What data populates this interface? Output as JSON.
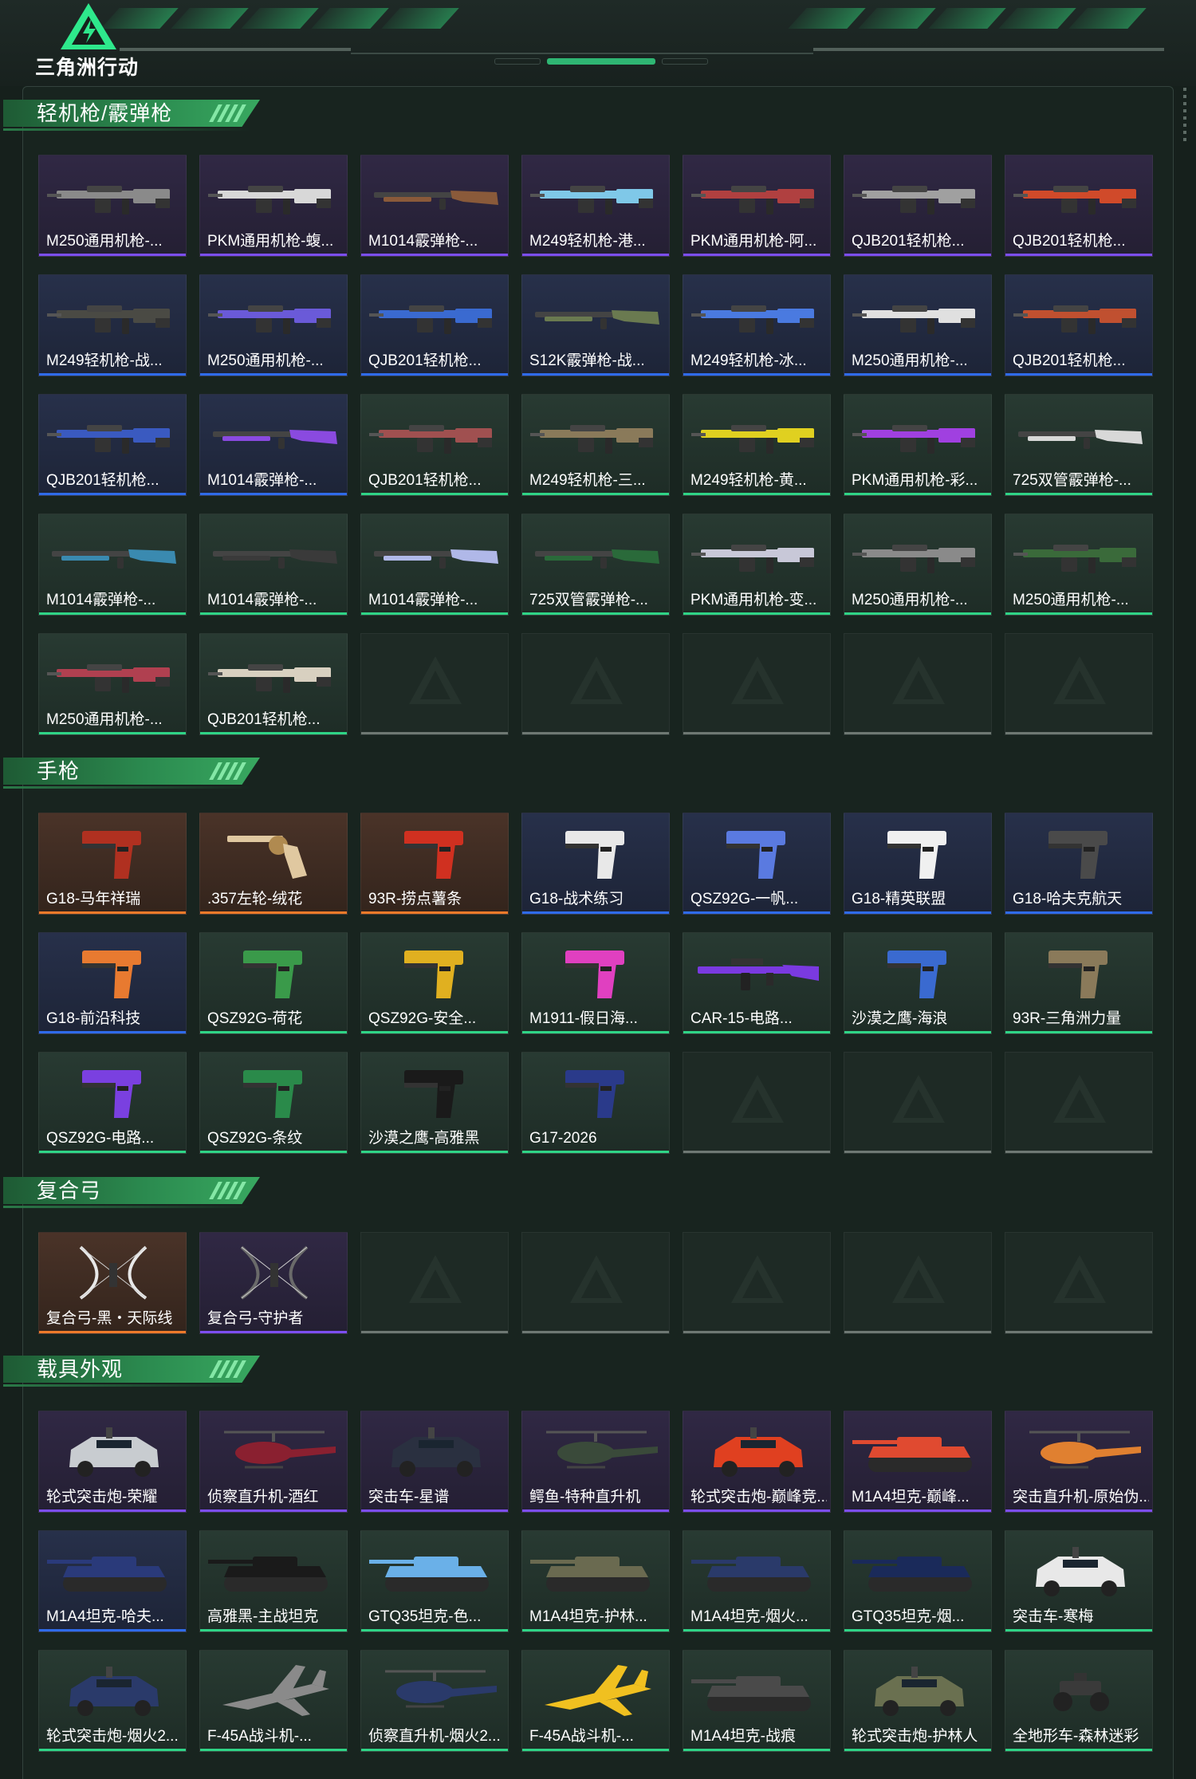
{
  "app": {
    "logo_text": "三角洲行动"
  },
  "colors": {
    "purple": "#7c4ef0",
    "blue": "#2f6bea",
    "green": "#2fd486",
    "orange": "#ee7a2a",
    "empty": "#6e7873",
    "accent": "#38a860"
  },
  "sections": [
    {
      "title": "轻机枪/霰弹枪",
      "empty_slots": 5,
      "items": [
        {
          "label": "M250通用机枪-...",
          "rarity": "purple",
          "art": "lmg",
          "hue": "#8a8a8a"
        },
        {
          "label": "PKM通用机枪-蝮...",
          "rarity": "purple",
          "art": "lmg",
          "hue": "#d8d8d8"
        },
        {
          "label": "M1014霰弹枪-...",
          "rarity": "purple",
          "art": "shotgun",
          "hue": "#8a5a3a"
        },
        {
          "label": "M249轻机枪-港...",
          "rarity": "purple",
          "art": "lmg",
          "hue": "#7fc8e8"
        },
        {
          "label": "PKM通用机枪-阿...",
          "rarity": "purple",
          "art": "lmg",
          "hue": "#b04040"
        },
        {
          "label": "QJB201轻机枪...",
          "rarity": "purple",
          "art": "lmg",
          "hue": "#a0a0a0"
        },
        {
          "label": "QJB201轻机枪...",
          "rarity": "purple",
          "art": "lmg",
          "hue": "#d04a2a"
        },
        {
          "label": "M249轻机枪-战...",
          "rarity": "blue",
          "art": "lmg",
          "hue": "#4a4a44"
        },
        {
          "label": "M250通用机枪-...",
          "rarity": "blue",
          "art": "lmg",
          "hue": "#6a5ad8"
        },
        {
          "label": "QJB201轻机枪...",
          "rarity": "blue",
          "art": "lmg",
          "hue": "#3a6ad0"
        },
        {
          "label": "S12K霰弹枪-战...",
          "rarity": "blue",
          "art": "shotgun",
          "hue": "#6a7a50"
        },
        {
          "label": "M249轻机枪-冰...",
          "rarity": "blue",
          "art": "lmg",
          "hue": "#4a7ae0"
        },
        {
          "label": "M250通用机枪-...",
          "rarity": "blue",
          "art": "lmg",
          "hue": "#e0e0e0"
        },
        {
          "label": "QJB201轻机枪...",
          "rarity": "blue",
          "art": "lmg",
          "hue": "#c05030"
        },
        {
          "label": "QJB201轻机枪...",
          "rarity": "blue",
          "art": "lmg",
          "hue": "#3a5ac0"
        },
        {
          "label": "M1014霰弹枪-...",
          "rarity": "blue",
          "art": "shotgun",
          "hue": "#8a4ae0"
        },
        {
          "label": "QJB201轻机枪...",
          "rarity": "green",
          "art": "lmg",
          "hue": "#a05050"
        },
        {
          "label": "M249轻机枪-三...",
          "rarity": "green",
          "art": "lmg",
          "hue": "#8a7a5a"
        },
        {
          "label": "M249轻机枪-黄...",
          "rarity": "green",
          "art": "lmg",
          "hue": "#e0d020"
        },
        {
          "label": "PKM通用机枪-彩...",
          "rarity": "green",
          "art": "lmg",
          "hue": "#a040e0"
        },
        {
          "label": "725双管霰弹枪-...",
          "rarity": "green",
          "art": "shotgun",
          "hue": "#d8d8d8"
        },
        {
          "label": "M1014霰弹枪-...",
          "rarity": "green",
          "art": "shotgun",
          "hue": "#3a8ab0"
        },
        {
          "label": "M1014霰弹枪-...",
          "rarity": "green",
          "art": "shotgun",
          "hue": "#3a3a3a"
        },
        {
          "label": "M1014霰弹枪-...",
          "rarity": "green",
          "art": "shotgun",
          "hue": "#b0b8e8"
        },
        {
          "label": "725双管霰弹枪-...",
          "rarity": "green",
          "art": "shotgun",
          "hue": "#2a6a3a"
        },
        {
          "label": "PKM通用机枪-变...",
          "rarity": "green",
          "art": "lmg",
          "hue": "#c8c8d8"
        },
        {
          "label": "M250通用机枪-...",
          "rarity": "green",
          "art": "lmg",
          "hue": "#8a8a8a"
        },
        {
          "label": "M250通用机枪-...",
          "rarity": "green",
          "art": "lmg",
          "hue": "#3a6a3a"
        },
        {
          "label": "M250通用机枪-...",
          "rarity": "green",
          "art": "lmg",
          "hue": "#b04050"
        },
        {
          "label": "QJB201轻机枪...",
          "rarity": "green",
          "art": "lmg",
          "hue": "#d8d0c0"
        }
      ]
    },
    {
      "title": "手枪",
      "empty_slots": 3,
      "items": [
        {
          "label": "G18-马年祥瑞",
          "rarity": "orange",
          "art": "pistol",
          "hue": "#b03020"
        },
        {
          "label": ".357左轮-绒花",
          "rarity": "orange",
          "art": "revolver",
          "hue": "#e0c8a0"
        },
        {
          "label": "93R-捞点薯条",
          "rarity": "orange",
          "art": "pistol",
          "hue": "#d03020"
        },
        {
          "label": "G18-战术练习",
          "rarity": "blue",
          "art": "pistol",
          "hue": "#e8e8e8"
        },
        {
          "label": "QSZ92G-一帆...",
          "rarity": "blue",
          "art": "pistol",
          "hue": "#5a7ae0"
        },
        {
          "label": "G18-精英联盟",
          "rarity": "blue",
          "art": "pistol",
          "hue": "#f0f0f0"
        },
        {
          "label": "G18-哈夫克航天",
          "rarity": "blue",
          "art": "pistol",
          "hue": "#4a4a4a"
        },
        {
          "label": "G18-前沿科技",
          "rarity": "blue",
          "art": "pistol",
          "hue": "#e87a30"
        },
        {
          "label": "QSZ92G-荷花",
          "rarity": "green",
          "art": "pistol",
          "hue": "#3a9a4a"
        },
        {
          "label": "QSZ92G-安全...",
          "rarity": "green",
          "art": "pistol",
          "hue": "#e0b020"
        },
        {
          "label": "M1911-假日海...",
          "rarity": "green",
          "art": "pistol",
          "hue": "#e040c0"
        },
        {
          "label": "CAR-15-电路...",
          "rarity": "green",
          "art": "rifle",
          "hue": "#7a3ae0"
        },
        {
          "label": "沙漠之鹰-海浪",
          "rarity": "green",
          "art": "pistol",
          "hue": "#3a6ad0"
        },
        {
          "label": "93R-三角洲力量",
          "rarity": "green",
          "art": "pistol",
          "hue": "#8a7a5a"
        },
        {
          "label": "QSZ92G-电路...",
          "rarity": "green",
          "art": "pistol",
          "hue": "#7a40e0"
        },
        {
          "label": "QSZ92G-条纹",
          "rarity": "green",
          "art": "pistol",
          "hue": "#2a8a4a"
        },
        {
          "label": "沙漠之鹰-高雅黑",
          "rarity": "green",
          "art": "pistol",
          "hue": "#1a1a1a"
        },
        {
          "label": "G17-2026",
          "rarity": "green",
          "art": "pistol",
          "hue": "#2a3a8a"
        }
      ]
    },
    {
      "title": "复合弓",
      "empty_slots": 5,
      "items": [
        {
          "label": "复合弓-黑・天际线",
          "rarity": "orange",
          "art": "bow",
          "hue": "#e8e8e8"
        },
        {
          "label": "复合弓-守护者",
          "rarity": "purple",
          "art": "bow",
          "hue": "#6a6a6a"
        }
      ]
    },
    {
      "title": "载具外观",
      "empty_slots": 0,
      "items": [
        {
          "label": "轮式突击炮-荣耀",
          "rarity": "purple",
          "art": "car",
          "hue": "#c8ccd0"
        },
        {
          "label": "侦察直升机-酒红",
          "rarity": "purple",
          "art": "heli",
          "hue": "#8a2030"
        },
        {
          "label": "突击车-星谱",
          "rarity": "purple",
          "art": "car",
          "hue": "#2a3040"
        },
        {
          "label": "鳄鱼-特种直升机",
          "rarity": "purple",
          "art": "heli",
          "hue": "#3a4a3a"
        },
        {
          "label": "轮式突击炮-巅峰竞...",
          "rarity": "purple",
          "art": "car",
          "hue": "#e04020"
        },
        {
          "label": "M1A4坦克-巅峰...",
          "rarity": "purple",
          "art": "tank",
          "hue": "#e04a30"
        },
        {
          "label": "突击直升机-原始伪...",
          "rarity": "purple",
          "art": "heli",
          "hue": "#e08030"
        },
        {
          "label": "M1A4坦克-哈夫...",
          "rarity": "blue",
          "art": "tank",
          "hue": "#2a3a7a"
        },
        {
          "label": "高雅黑-主战坦克",
          "rarity": "green",
          "art": "tank",
          "hue": "#1a1a1a"
        },
        {
          "label": "GTQ35坦克-色...",
          "rarity": "green",
          "art": "tank",
          "hue": "#6ab0e8"
        },
        {
          "label": "M1A4坦克-护林...",
          "rarity": "green",
          "art": "tank",
          "hue": "#6a6a50"
        },
        {
          "label": "M1A4坦克-烟火...",
          "rarity": "green",
          "art": "tank",
          "hue": "#2a3a6a"
        },
        {
          "label": "GTQ35坦克-烟...",
          "rarity": "green",
          "art": "tank",
          "hue": "#1a2a5a"
        },
        {
          "label": "突击车-寒梅",
          "rarity": "green",
          "art": "car",
          "hue": "#e8e8e8"
        },
        {
          "label": "轮式突击炮-烟火2...",
          "rarity": "green",
          "art": "car",
          "hue": "#2a3a6a"
        },
        {
          "label": "F-45A战斗机-...",
          "rarity": "green",
          "art": "jet",
          "hue": "#8a8a8a"
        },
        {
          "label": "侦察直升机-烟火2...",
          "rarity": "green",
          "art": "heli",
          "hue": "#2a3a6a"
        },
        {
          "label": "F-45A战斗机-...",
          "rarity": "green",
          "art": "jet",
          "hue": "#f0c020"
        },
        {
          "label": "M1A4坦克-战痕",
          "rarity": "green",
          "art": "tank",
          "hue": "#4a4a4a"
        },
        {
          "label": "轮式突击炮-护林人",
          "rarity": "green",
          "art": "car",
          "hue": "#6a7050"
        },
        {
          "label": "全地形车-森林迷彩",
          "rarity": "green",
          "art": "atv",
          "hue": "#3a3a3a"
        }
      ]
    }
  ]
}
